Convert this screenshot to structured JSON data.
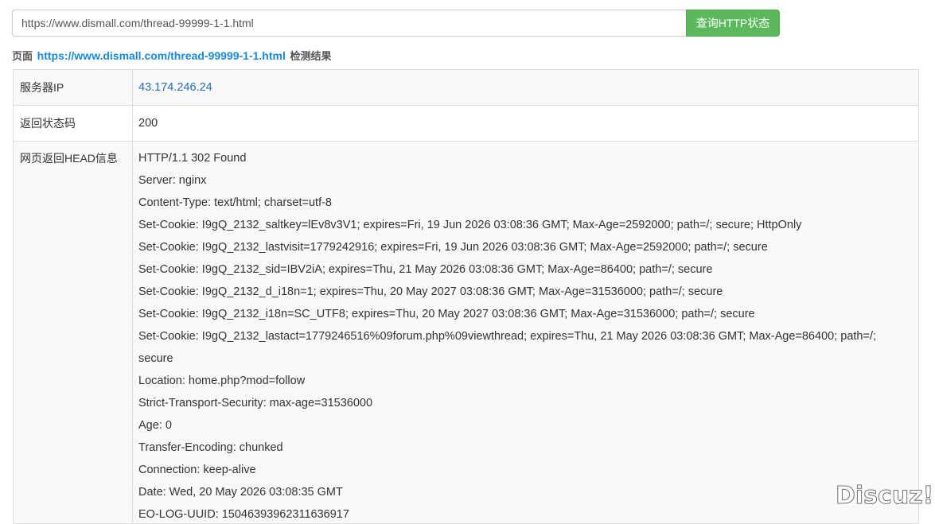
{
  "search": {
    "url_value": "https://www.dismall.com/thread-99999-1-1.html",
    "button_label": "查询HTTP状态"
  },
  "caption": {
    "prefix": "页面",
    "url": "https://www.dismall.com/thread-99999-1-1.html",
    "suffix": "检测结果"
  },
  "table": {
    "ip_label": "服务器IP",
    "ip_value": "43.174.246.24",
    "status_label": "返回状态码",
    "status_value": "200",
    "head_label": "网页返回HEAD信息",
    "head_lines": [
      "HTTP/1.1 302 Found",
      "Server: nginx",
      "Content-Type: text/html; charset=utf-8",
      "Set-Cookie: I9gQ_2132_saltkey=lEv8v3V1; expires=Fri, 19 Jun 2026 03:08:36 GMT; Max-Age=2592000; path=/; secure; HttpOnly",
      "Set-Cookie: I9gQ_2132_lastvisit=1779242916; expires=Fri, 19 Jun 2026 03:08:36 GMT; Max-Age=2592000; path=/; secure",
      "Set-Cookie: I9gQ_2132_sid=IBV2iA; expires=Thu, 21 May 2026 03:08:36 GMT; Max-Age=86400; path=/; secure",
      "Set-Cookie: I9gQ_2132_d_i18n=1; expires=Thu, 20 May 2027 03:08:36 GMT; Max-Age=31536000; path=/; secure",
      "Set-Cookie: I9gQ_2132_i18n=SC_UTF8; expires=Thu, 20 May 2027 03:08:36 GMT; Max-Age=31536000; path=/; secure",
      "Set-Cookie: I9gQ_2132_lastact=1779246516%09forum.php%09viewthread; expires=Thu, 21 May 2026 03:08:36 GMT; Max-Age=86400; path=/;",
      "secure",
      "Location: home.php?mod=follow",
      "Strict-Transport-Security: max-age=31536000",
      "Age: 0",
      "Transfer-Encoding: chunked",
      "Connection: keep-alive",
      "Date: Wed, 20 May 2026 03:08:35 GMT",
      "EO-LOG-UUID: 1504639396231163691​7"
    ]
  },
  "watermark": "Discuz!"
}
